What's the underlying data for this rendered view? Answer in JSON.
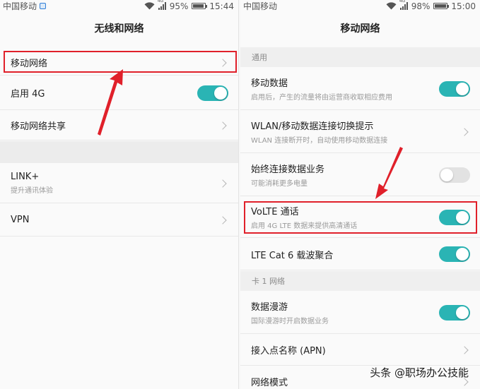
{
  "left": {
    "status": {
      "carrier": "中国移动",
      "network_badge": "4G",
      "battery_percent": "95%",
      "battery_level": 0.95,
      "time": "15:44"
    },
    "title": "无线和网络",
    "items": [
      {
        "title": "移动网络"
      },
      {
        "title": "启用 4G",
        "toggle": "on"
      },
      {
        "title": "移动网络共享"
      },
      {
        "title": "LINK+",
        "subtitle": "提升通讯体验"
      },
      {
        "title": "VPN"
      }
    ]
  },
  "right": {
    "status": {
      "carrier": "中国移动",
      "network_badge": "4G",
      "battery_percent": "98%",
      "battery_level": 0.98,
      "time": "15:00"
    },
    "title": "移动网络",
    "sections": {
      "general": "通用",
      "card1": "卡 1 网络"
    },
    "items": [
      {
        "title": "移动数据",
        "subtitle": "启用后，产生的流量将由运营商收取相应费用",
        "toggle": "on"
      },
      {
        "title": "WLAN/移动数据连接切换提示",
        "subtitle": "WLAN 连接断开时，自动使用移动数据连接"
      },
      {
        "title": "始终连接数据业务",
        "subtitle": "可能消耗更多电量",
        "toggle": "off"
      },
      {
        "title": "VoLTE 通话",
        "subtitle": "启用 4G LTE 数据来提供高清通话",
        "toggle": "on"
      },
      {
        "title": "LTE Cat 6 载波聚合",
        "toggle": "on"
      },
      {
        "title": "数据漫游",
        "subtitle": "国际漫游时开启数据业务",
        "toggle": "on"
      },
      {
        "title": "接入点名称 (APN)"
      },
      {
        "title": "网络模式"
      }
    ]
  },
  "watermark": "头条 @职场办公技能",
  "colors": {
    "toggle_on": "#2ab4b4",
    "toggle_off": "#e2e2e2",
    "annotation_red": "#e0202a"
  },
  "icons": {
    "chevron": "chevron-right-icon",
    "wifi": "wifi-icon",
    "signal": "signal-icon",
    "battery": "battery-icon",
    "sim": "sim-card-icon"
  }
}
